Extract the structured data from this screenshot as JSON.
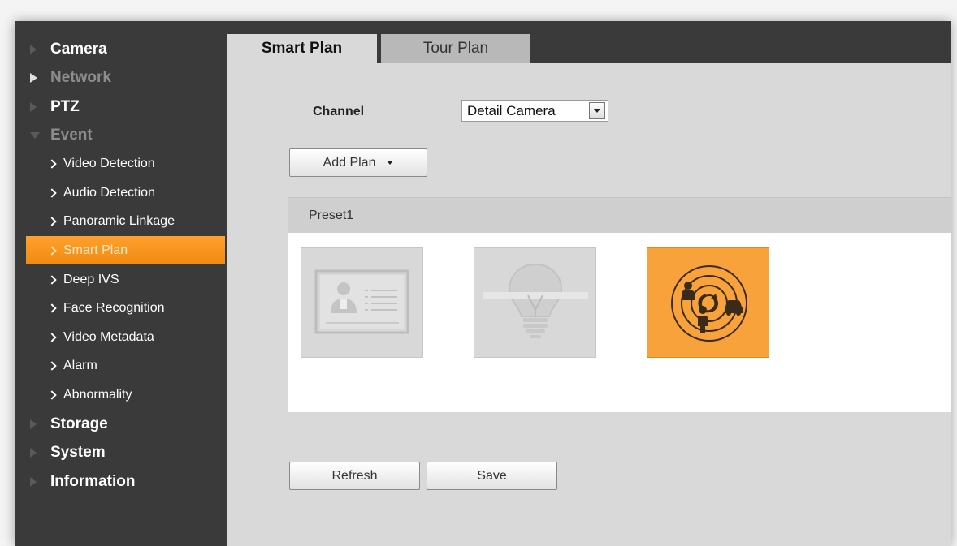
{
  "sidebar": {
    "items": [
      {
        "label": "Camera"
      },
      {
        "label": "Network"
      },
      {
        "label": "PTZ"
      },
      {
        "label": "Event"
      },
      {
        "label": "Video Detection"
      },
      {
        "label": "Audio Detection"
      },
      {
        "label": "Panoramic Linkage"
      },
      {
        "label": "Smart Plan"
      },
      {
        "label": "Deep IVS"
      },
      {
        "label": "Face Recognition"
      },
      {
        "label": "Video Metadata"
      },
      {
        "label": "Alarm"
      },
      {
        "label": "Abnormality"
      },
      {
        "label": "Storage"
      },
      {
        "label": "System"
      },
      {
        "label": "Information"
      }
    ],
    "active_item": "Smart Plan"
  },
  "tabs": [
    {
      "label": "Smart Plan",
      "active": true
    },
    {
      "label": "Tour Plan",
      "active": false
    }
  ],
  "form": {
    "channel_label": "Channel",
    "channel_value": "Detail Camera",
    "add_plan_label": "Add Plan"
  },
  "preset": {
    "name": "Preset1",
    "tiles": [
      {
        "icon": "face-id-card-icon",
        "selected": false
      },
      {
        "icon": "lightbulb-icon",
        "selected": false
      },
      {
        "icon": "radar-people-vehicle-icon",
        "selected": true
      }
    ]
  },
  "buttons": {
    "refresh_label": "Refresh",
    "save_label": "Save"
  },
  "colors": {
    "sidebar_bg": "#3a3a3a",
    "accent_orange": "#f7a23a",
    "content_bg": "#d9d9d9"
  }
}
